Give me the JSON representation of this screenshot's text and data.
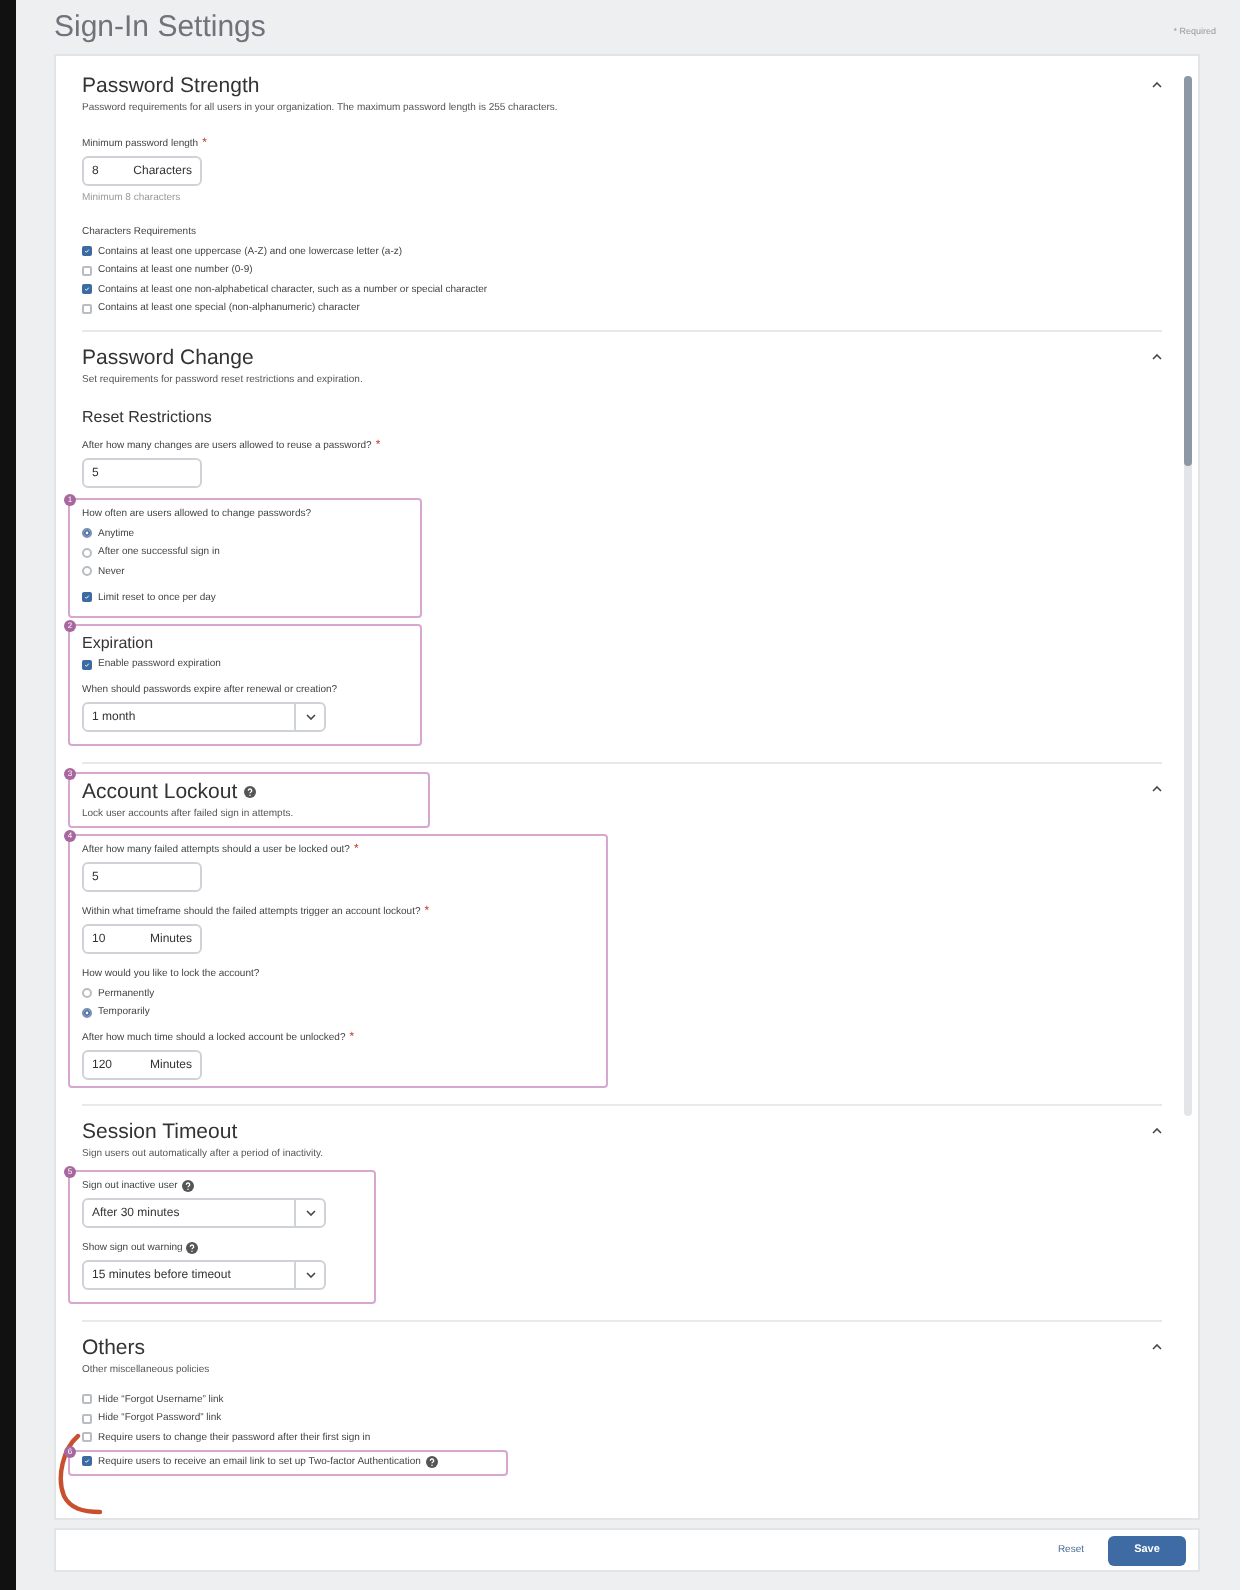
{
  "page": {
    "title": "Sign-In Settings",
    "required_note": "* Required"
  },
  "sections": [
    {
      "title": "Password Strength",
      "description": "Password requirements for all users in your organization. The maximum password length is 255 characters.",
      "expanded": true,
      "blocks": [
        {
          "kind": "label",
          "text": "Minimum password length",
          "required_mark": "*"
        },
        {
          "kind": "unit_input",
          "value": "8",
          "unit": "Characters"
        },
        {
          "kind": "hint",
          "text": "Minimum 8 characters"
        },
        {
          "kind": "caption",
          "text": "Characters Requirements"
        },
        {
          "kind": "checkbox",
          "text": "Contains at least one uppercase (A-Z) and one lowercase letter (a-z)",
          "checked": true
        },
        {
          "kind": "checkbox",
          "text": "Contains at least one number (0-9)",
          "checked": false
        },
        {
          "kind": "checkbox",
          "text": "Contains at least one non-alphabetical character, such as a number or special character",
          "checked": true
        },
        {
          "kind": "checkbox",
          "text": "Contains at least one special (non-alphanumeric) character",
          "checked": false
        }
      ]
    },
    {
      "title": "Password Change",
      "description": "Set requirements for password reset restrictions and expiration.",
      "expanded": true,
      "blocks": [
        {
          "kind": "subheading",
          "text": "Reset Restrictions"
        },
        {
          "kind": "label",
          "text": "After how many changes are users allowed to reuse a password?",
          "required_mark": "*"
        },
        {
          "kind": "input",
          "value": "5"
        },
        {
          "kind": "group",
          "marker": "1",
          "blocks": [
            {
              "kind": "label",
              "text": "How often are users allowed to change passwords?"
            },
            {
              "kind": "radio",
              "text": "Anytime",
              "selected": true
            },
            {
              "kind": "radio",
              "text": "After one successful sign in",
              "selected": false
            },
            {
              "kind": "radio",
              "text": "Never",
              "selected": false
            },
            {
              "kind": "checkbox",
              "text": "Limit reset to once per day",
              "checked": true
            }
          ]
        },
        {
          "kind": "group",
          "marker": "2",
          "blocks": [
            {
              "kind": "subheading",
              "text": "Expiration"
            },
            {
              "kind": "checkbox",
              "text": "Enable password expiration",
              "checked": true
            },
            {
              "kind": "label",
              "text": "When should passwords expire after renewal or creation?"
            },
            {
              "kind": "select",
              "value": "1 month"
            }
          ]
        }
      ]
    },
    {
      "title": "Account Lockout",
      "help": true,
      "marker": "3",
      "description": "Lock user accounts after failed sign in attempts.",
      "expanded": true,
      "blocks": [
        {
          "kind": "group",
          "marker": "4",
          "blocks": [
            {
              "kind": "label",
              "text": "After how many failed attempts should a user be locked out?",
              "required_mark": "*"
            },
            {
              "kind": "input",
              "value": "5"
            },
            {
              "kind": "label",
              "text": "Within what timeframe should the failed attempts trigger an account lockout?",
              "required_mark": "*"
            },
            {
              "kind": "unit_input",
              "value": "10",
              "unit": "Minutes"
            },
            {
              "kind": "label",
              "text": "How would you like to lock the account?"
            },
            {
              "kind": "radio",
              "text": "Permanently",
              "selected": false
            },
            {
              "kind": "radio",
              "text": "Temporarily",
              "selected": true
            },
            {
              "kind": "label",
              "text": "After how much time should a locked account be unlocked?",
              "required_mark": "*"
            },
            {
              "kind": "unit_input",
              "value": "120",
              "unit": "Minutes"
            }
          ]
        }
      ]
    },
    {
      "title": "Session Timeout",
      "description": "Sign users out automatically after a period of inactivity.",
      "expanded": true,
      "blocks": [
        {
          "kind": "group",
          "marker": "5",
          "blocks": [
            {
              "kind": "label",
              "text": "Sign out inactive user",
              "help": true
            },
            {
              "kind": "select",
              "value": "After 30 minutes"
            },
            {
              "kind": "label",
              "text": "Show sign out warning",
              "help": true
            },
            {
              "kind": "select",
              "value": "15 minutes before timeout"
            }
          ]
        }
      ]
    },
    {
      "title": "Others",
      "description": "Other miscellaneous policies",
      "expanded": true,
      "blocks": [
        {
          "kind": "checkbox",
          "text": "Hide “Forgot Username” link",
          "checked": false
        },
        {
          "kind": "checkbox",
          "text": "Hide “Forgot Password” link",
          "checked": false
        },
        {
          "kind": "checkbox",
          "text": "Require users to change their password after their first sign in",
          "checked": false
        },
        {
          "kind": "group",
          "marker": "6",
          "blocks": [
            {
              "kind": "checkbox",
              "text": "Require users to receive an email link to set up Two-factor Authentication",
              "checked": true,
              "help": true
            }
          ]
        }
      ]
    }
  ],
  "footer": {
    "buttons": [
      {
        "label": "Reset",
        "kind": "link"
      },
      {
        "label": "Save",
        "kind": "primary"
      }
    ]
  }
}
